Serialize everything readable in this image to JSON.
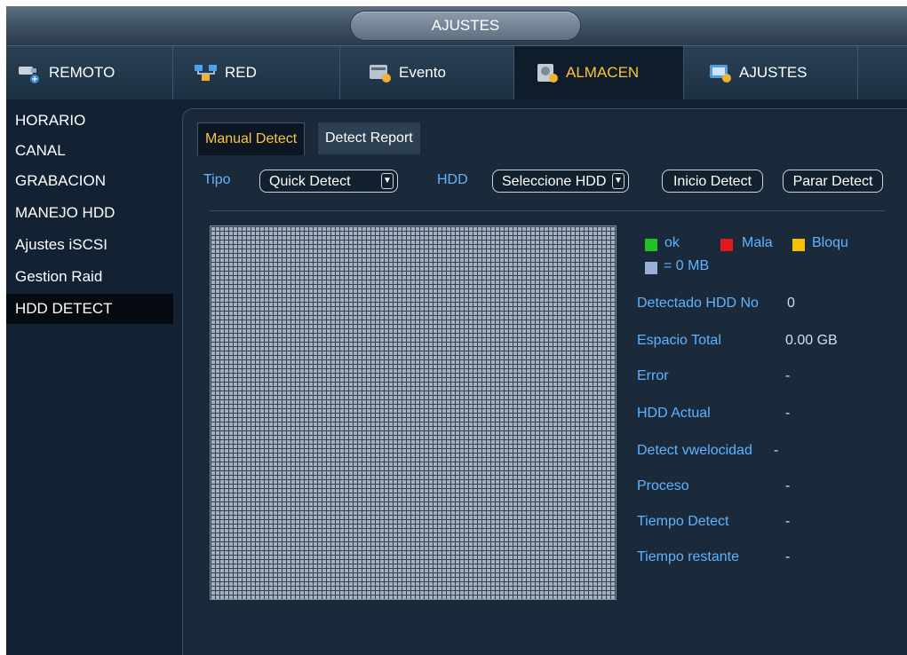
{
  "window_title": "AJUSTES",
  "main_tabs": [
    {
      "label": "REMOTO",
      "icon": "network-camera-icon"
    },
    {
      "label": "RED",
      "icon": "network-icon"
    },
    {
      "label": "Evento",
      "icon": "event-icon"
    },
    {
      "label": "ALMACEN",
      "icon": "storage-icon",
      "active": true
    },
    {
      "label": "AJUSTES",
      "icon": "settings-icon"
    }
  ],
  "sidebar": {
    "items": [
      {
        "label": "HORARIO"
      },
      {
        "label": "CANAL"
      },
      {
        "label": "GRABACION"
      },
      {
        "label": "MANEJO HDD"
      },
      {
        "label": "Ajustes iSCSI"
      },
      {
        "label": "Gestion Raid"
      },
      {
        "label": "HDD DETECT",
        "active": true
      }
    ]
  },
  "subtabs": [
    {
      "label": "Manual Detect",
      "active": true
    },
    {
      "label": "Detect Report"
    }
  ],
  "controls": {
    "tipo_label": "Tipo",
    "tipo_value": "Quick Detect",
    "hdd_label": "HDD",
    "hdd_value": "Seleccione HDD",
    "start_button": "Inicio Detect",
    "stop_button": "Parar Detect"
  },
  "legend": {
    "ok": "ok",
    "bad": "Mala",
    "blocked": "Bloqu",
    "empty": "= 0 MB"
  },
  "info": [
    {
      "label": "Detectado HDD No",
      "value": "0"
    },
    {
      "label": "Espacio Total",
      "value": "0.00 GB"
    },
    {
      "label": "Error",
      "value": "-"
    },
    {
      "label": "HDD Actual",
      "value": "-"
    },
    {
      "label": "Detect vwelocidad",
      "value": "-"
    },
    {
      "label": "Proceso",
      "value": "-"
    },
    {
      "label": "Tiempo Detect",
      "value": "-"
    },
    {
      "label": "Tiempo restante",
      "value": "-"
    }
  ],
  "colors": {
    "accent": "#ffc43a",
    "ok": "#22c022",
    "bad": "#e01b1b",
    "blocked": "#f2c200",
    "empty": "#9ab0d8",
    "value_text": "#c9e0f5"
  }
}
